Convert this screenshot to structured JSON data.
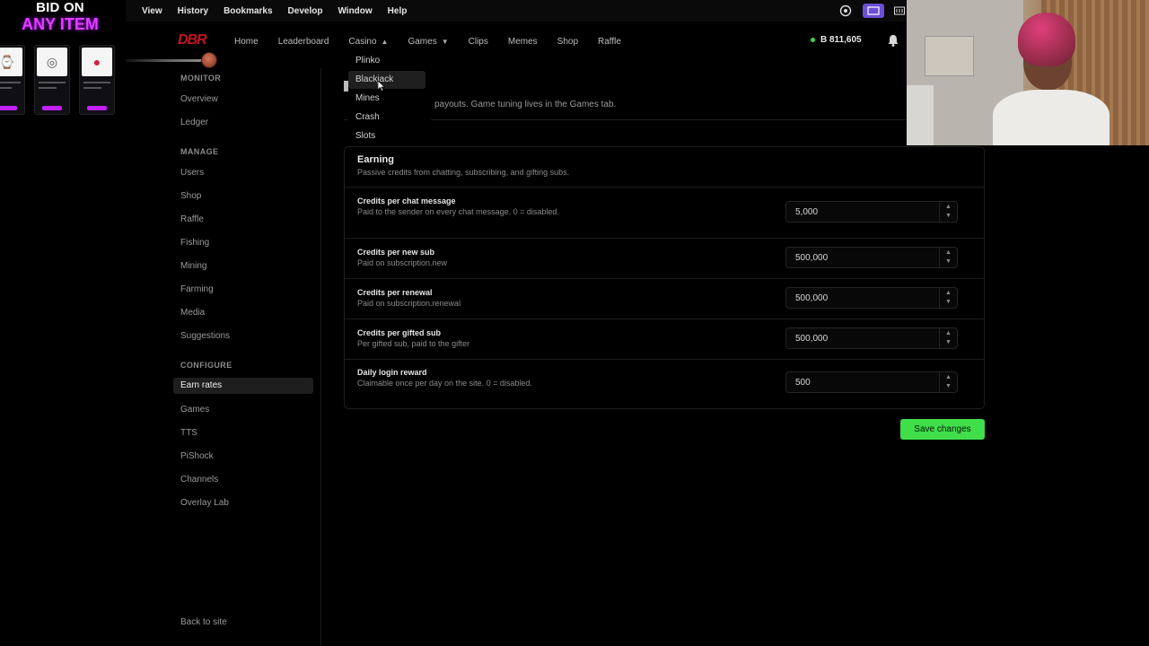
{
  "promo": {
    "line1": "BID ON",
    "line2": "ANY ITEM",
    "cards": [
      {
        "thumb": "⌚"
      },
      {
        "thumb": "◎"
      },
      {
        "thumb": "●"
      }
    ]
  },
  "menubar": {
    "items": [
      "View",
      "History",
      "Bookmarks",
      "Develop",
      "Window",
      "Help"
    ],
    "overflow": ":"
  },
  "site": {
    "logo": "DBR",
    "nav": [
      {
        "label": "Home"
      },
      {
        "label": "Leaderboard"
      },
      {
        "label": "Casino",
        "chevron": "▲"
      },
      {
        "label": "Games",
        "chevron": "▼"
      },
      {
        "label": "Clips"
      },
      {
        "label": "Memes"
      },
      {
        "label": "Shop"
      },
      {
        "label": "Raffle"
      }
    ],
    "balance": "B 811,605"
  },
  "casino_dropdown": {
    "items": [
      "Plinko",
      "Blackjack",
      "Mines",
      "Crash",
      "Slots"
    ],
    "hovered": "Blackjack"
  },
  "sidebar": {
    "sections": [
      {
        "title": "MONITOR",
        "items": [
          "Overview",
          "Ledger"
        ]
      },
      {
        "title": "MANAGE",
        "items": [
          "Users",
          "Shop",
          "Raffle",
          "Fishing",
          "Mining",
          "Farming",
          "Media",
          "Suggestions"
        ]
      },
      {
        "title": "CONFIGURE",
        "items": [
          "Earn rates",
          "Games",
          "TTS",
          "PiShock",
          "Channels",
          "Overlay Lab"
        ]
      }
    ],
    "active": "Earn rates",
    "back": "Back to site"
  },
  "main": {
    "subtitle_visible": "payouts. Game tuning lives in the Games tab.",
    "panel": {
      "title": "Earning",
      "description": "Passive credits from chatting, subscribing, and gifting subs.",
      "rows": [
        {
          "label": "Credits per chat message",
          "desc": "Paid to the sender on every chat message. 0 = disabled.",
          "value": "5,000"
        },
        {
          "label": "Credits per new sub",
          "desc": "Paid on subscription.new",
          "value": "500,000"
        },
        {
          "label": "Credits per renewal",
          "desc": "Paid on subscription.renewal",
          "value": "500,000"
        },
        {
          "label": "Credits per gifted sub",
          "desc": "Per gifted sub, paid to the gifter",
          "value": "500,000"
        },
        {
          "label": "Daily login reward",
          "desc": "Claimable once per day on the site. 0 = disabled.",
          "value": "500"
        }
      ]
    },
    "save_label": "Save changes"
  },
  "colors": {
    "accent_green": "#3fde4a",
    "logo_red": "#c1141f",
    "promo_purple": "#e040fb"
  }
}
